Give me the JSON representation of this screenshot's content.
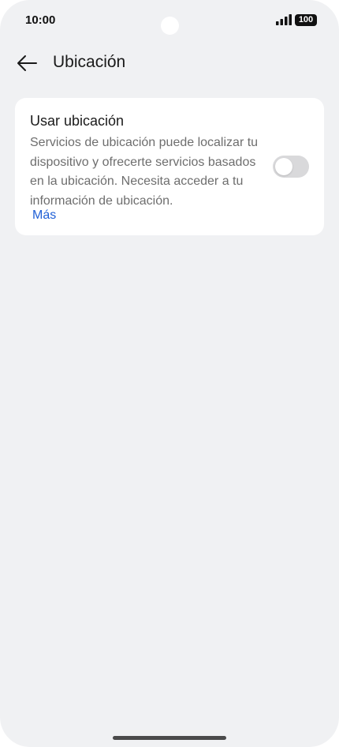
{
  "status_bar": {
    "time": "10:00",
    "battery": "100",
    "signal_icon": "signal-bars-icon"
  },
  "app_bar": {
    "title": "Ubicación",
    "back_icon": "arrow-left-icon"
  },
  "location_card": {
    "title": "Usar ubicación",
    "description": "Servicios de ubicación puede localizar tu dispositivo y ofrecerte servicios basados en la ubicación. Necesita acceder a tu información de ubicación.",
    "more_link": "Más",
    "toggle_on": false
  },
  "colors": {
    "background": "#f0f1f3",
    "card": "#ffffff",
    "link": "#1f5fd6",
    "toggle_off": "#d9d9db"
  }
}
